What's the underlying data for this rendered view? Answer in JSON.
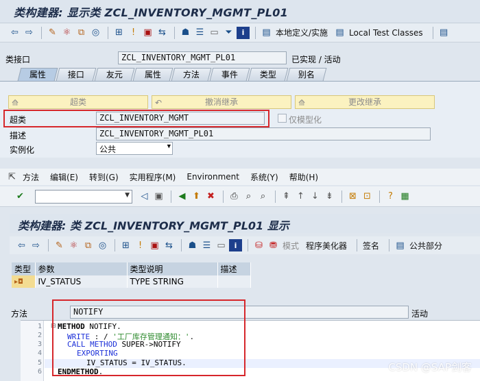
{
  "top_window": {
    "title": "类构建器: 显示类 ZCL_INVENTORY_MGMT_PL01",
    "toolbar": {
      "local_defs_label": "本地定义/实施",
      "local_test_label": "Local Test Classes"
    },
    "interface_label": "类接口",
    "class_name": "ZCL_INVENTORY_MGMT_PL01",
    "status": "已实现 / 活动",
    "tabs": [
      "属性",
      "接口",
      "友元",
      "属性",
      "方法",
      "事件",
      "类型",
      "别名"
    ],
    "active_tab_index": 0,
    "inherit_buttons": {
      "superclass": "超类",
      "undo_inherit": "撤消继承",
      "change_inherit": "更改继承"
    },
    "superclass_label": "超类",
    "superclass_value": "ZCL_INVENTORY_MGMT",
    "modeled_only_label": "仅模型化",
    "description_label": "描述",
    "description_value": "ZCL_INVENTORY_MGMT_PL01",
    "instantiation_label": "实例化",
    "instantiation_value": "公共"
  },
  "menu": {
    "items": [
      "方法",
      "编辑(E)",
      "转到(G)",
      "实用程序(M)",
      "Environment",
      "系统(Y)",
      "帮助(H)"
    ]
  },
  "second_window": {
    "title": "类构建器: 类 ZCL_INVENTORY_MGMT_PL01 显示",
    "toolbar": {
      "mode_label": "模式",
      "pretty_printer_label": "程序美化器",
      "signature_label": "签名",
      "public_section_label": "公共部分"
    },
    "params": {
      "headers": [
        "类型",
        "参数",
        "类型说明",
        "描述"
      ],
      "rows": [
        {
          "type_icon": "▸◘",
          "name": "IV_STATUS",
          "type_desc": "TYPE STRING",
          "description": ""
        }
      ]
    },
    "method_label": "方法",
    "method_name": "NOTIFY",
    "method_status": "活动",
    "code": {
      "line_numbers": [
        "1",
        "2",
        "3",
        "4",
        "5",
        "6"
      ],
      "l1_kw": "METHOD",
      "l1_rest": " NOTIFY.",
      "l2_kw": "WRITE",
      "l2_mid": " : / ",
      "l2_str": "'工厂库存管理通知：'",
      "l2_end": ".",
      "l3_kw1": "CALL METHOD",
      "l3_rest": " SUPER->NOTIFY",
      "l4_kw": "EXPORTING",
      "l5_text": "IV_STATUS = IV_STATUS.",
      "l6_kw": "ENDMETHOD",
      "l6_end": "."
    }
  },
  "watermark": "CSDN @SAP剑客",
  "colors": {
    "highlight_border": "#d6262a",
    "title_text": "#1d2d4a",
    "yellow_button": "#fbf2c0",
    "keyword": "#1b2fd8",
    "string_literal": "#2d8a2d"
  }
}
